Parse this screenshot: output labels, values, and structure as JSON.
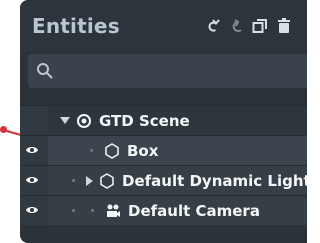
{
  "panel": {
    "title": "Entities",
    "toolbar": [
      "undo-icon",
      "redo-icon",
      "duplicate-icon",
      "delete-icon"
    ]
  },
  "search": {
    "icon": "search-icon",
    "placeholder": "",
    "value": ""
  },
  "tree": [
    {
      "label": "GTD Scene",
      "icon": "scene-target-icon",
      "expander": "expanded",
      "depth": 0,
      "visible_toggle": false
    },
    {
      "label": "Box",
      "icon": "hexagon-icon",
      "expander": "none",
      "depth": 1,
      "visible_toggle": true,
      "selected": true
    },
    {
      "label": "Default Dynamic Light",
      "icon": "hexagon-icon",
      "expander": "collapsed",
      "depth": 1,
      "visible_toggle": true
    },
    {
      "label": "Default Camera",
      "icon": "camera-icon",
      "expander": "none",
      "depth": 1,
      "visible_toggle": true
    }
  ],
  "colors": {
    "panel_background": "#2b3238",
    "title_text": "#b8c7d1",
    "tree_text": "#f4f7f8",
    "pointer": "#d8313a"
  }
}
